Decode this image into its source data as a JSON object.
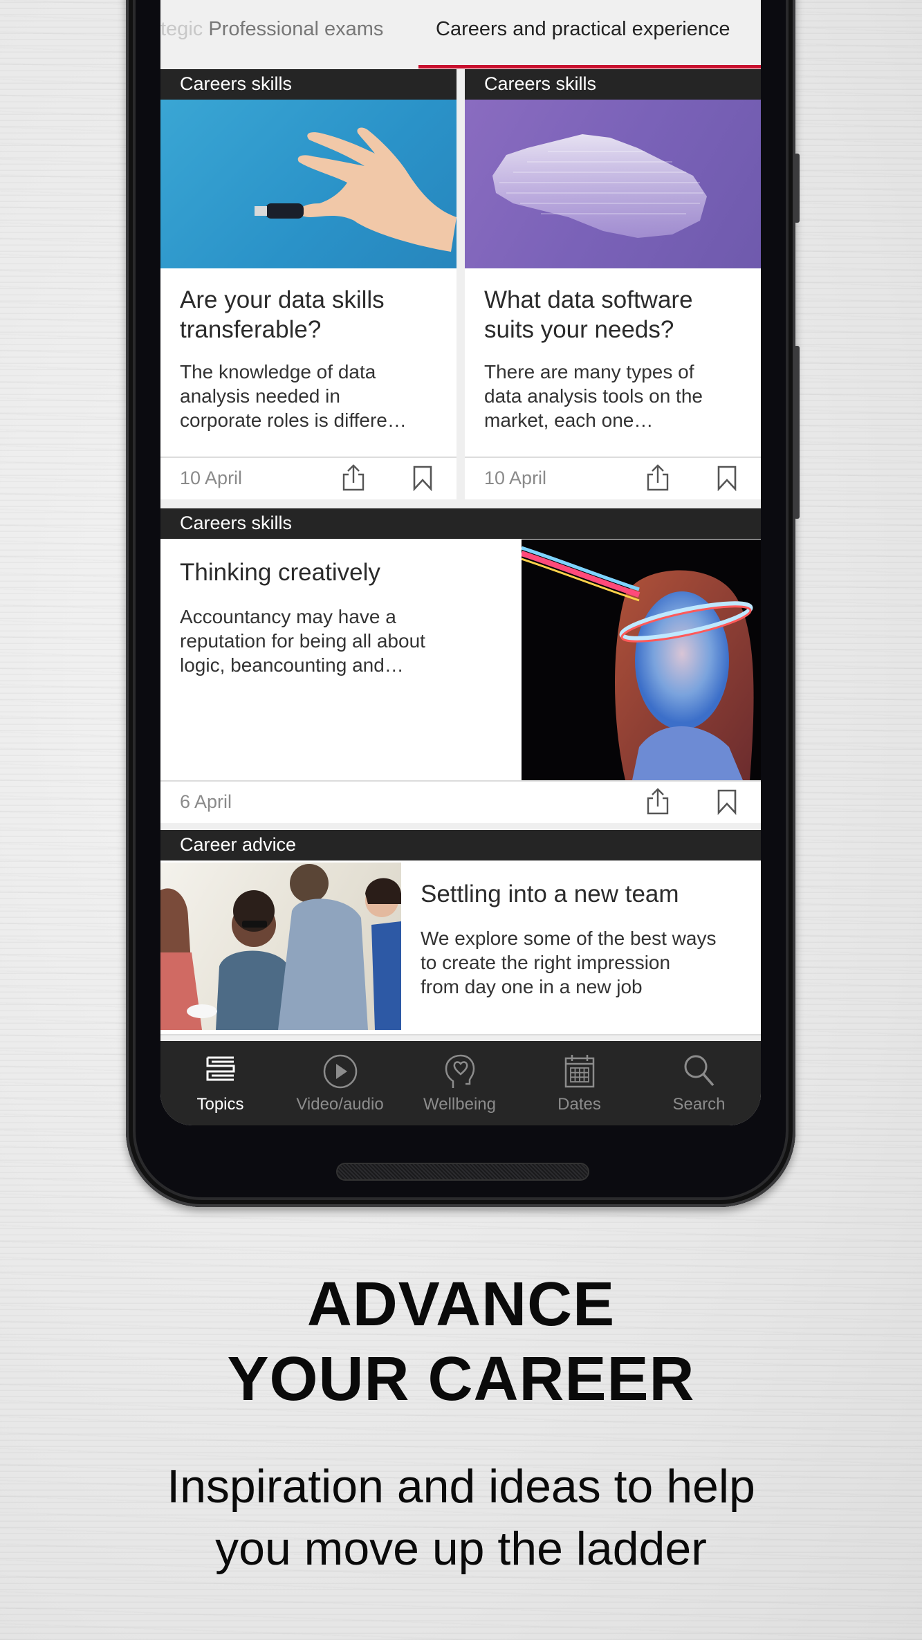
{
  "tabs": {
    "items": [
      {
        "label_prefix": "tegic",
        "label": " Professional exams",
        "active": false
      },
      {
        "label": "Careers and practical experience",
        "active": true
      }
    ],
    "accent_color": "#c8102e"
  },
  "articles": [
    {
      "category": "Careers skills",
      "title_line1": "Are your data skills",
      "title_line2": "transferable?",
      "desc_lines": [
        "The knowledge of data",
        "analysis needed in",
        "corporate roles is differe…"
      ],
      "date": "10 April",
      "image": "hand-holding-usb-drive"
    },
    {
      "category": "Careers skills",
      "title_line1": "What data software",
      "title_line2": "suits your needs?",
      "desc_lines": [
        "There are many types of",
        "data analysis tools on the",
        "market, each one…"
      ],
      "date": "10 April",
      "image": "purple-3d-data-visualization"
    },
    {
      "category": "Careers skills",
      "title_line1": "Thinking creatively",
      "desc_lines": [
        "Accountancy may have a",
        "reputation for being all about",
        "logic, beancounting and…"
      ],
      "date": "6 April",
      "image": "woman-with-light-trail"
    },
    {
      "category": "Career advice",
      "title_line1": "Settling into a new team",
      "desc_lines": [
        "We explore some of the best ways",
        "to create the right impression",
        "from day one in a new job"
      ],
      "image": "team-meeting-photo"
    }
  ],
  "bottom_nav": {
    "items": [
      {
        "label": "Topics",
        "icon": "topics-icon",
        "active": true
      },
      {
        "label": "Video/audio",
        "icon": "play-icon",
        "active": false
      },
      {
        "label": "Wellbeing",
        "icon": "head-heart-icon",
        "active": false
      },
      {
        "label": "Dates",
        "icon": "calendar-icon",
        "active": false
      },
      {
        "label": "Search",
        "icon": "search-icon",
        "active": false
      }
    ]
  },
  "promo": {
    "headline_line1": "ADVANCE",
    "headline_line2": "YOUR CAREER",
    "subtitle_line1": "Inspiration and ideas to help",
    "subtitle_line2": "you move up the ladder"
  }
}
